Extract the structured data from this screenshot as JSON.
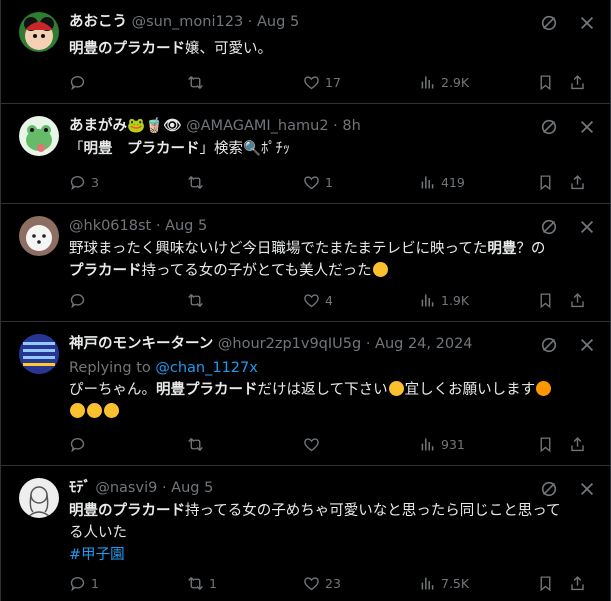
{
  "tweets": [
    {
      "name": "あおこう",
      "handle": "@sun_moni123",
      "sep": "·",
      "time": "Aug 5",
      "line1_em": "明豊のプラカード",
      "line1_rest": "嬢、可愛い。",
      "counts": {
        "replies": "",
        "retweets": "",
        "likes": "17",
        "views": "2.9K"
      }
    },
    {
      "name": "あまがみ🐸🧋👁",
      "handle": "@AMAGAMI_hamu2",
      "sep": "·",
      "time": "8h",
      "line1_pre": "「",
      "line1_em1": "明豊",
      "line1_mid": "　",
      "line1_em2": "プラカード",
      "line1_rest": "」検索🔍ﾎﾟﾁｯ",
      "counts": {
        "replies": "3",
        "retweets": "",
        "likes": "1",
        "views": "419"
      }
    },
    {
      "name": "",
      "handle": "@hk0618st",
      "sep": "·",
      "time": "Aug 5",
      "line1_a": "野球まったく興味ないけど今日職場でたまたまテレビに映ってた",
      "line1_em": "明豊",
      "line1_b": "？の",
      "line2_em": "プラカード",
      "line2_rest": "持ってる女の子がとても美人だった",
      "counts": {
        "replies": "",
        "retweets": "",
        "likes": "4",
        "views": "1.9K"
      }
    },
    {
      "name": "神戸のモンキーターン",
      "handle": "@hour2zp1v9qIU5g",
      "sep": "·",
      "time": "Aug 24, 2024",
      "replying_label": "Replying to",
      "replying_to": "@chan_1127x",
      "line1_a": "ぴーちゃん。",
      "line1_em": "明豊プラカード",
      "line1_b": "だけは返して下さい",
      "line1_c": "宜しくお願いします",
      "counts": {
        "replies": "",
        "retweets": "",
        "likes": "",
        "views": "931"
      }
    },
    {
      "name": "ﾓﾃﾞ",
      "handle": "@nasvi9",
      "sep": "·",
      "time": "Aug 5",
      "line1_em": "明豊のプラカード",
      "line1_rest": "持ってる女の子めちゃ可愛いなと思ったら同じこと思って",
      "line2": "る人いた",
      "hashtag": "#甲子園",
      "counts": {
        "replies": "1",
        "retweets": "1",
        "likes": "23",
        "views": "7.5K"
      }
    }
  ]
}
